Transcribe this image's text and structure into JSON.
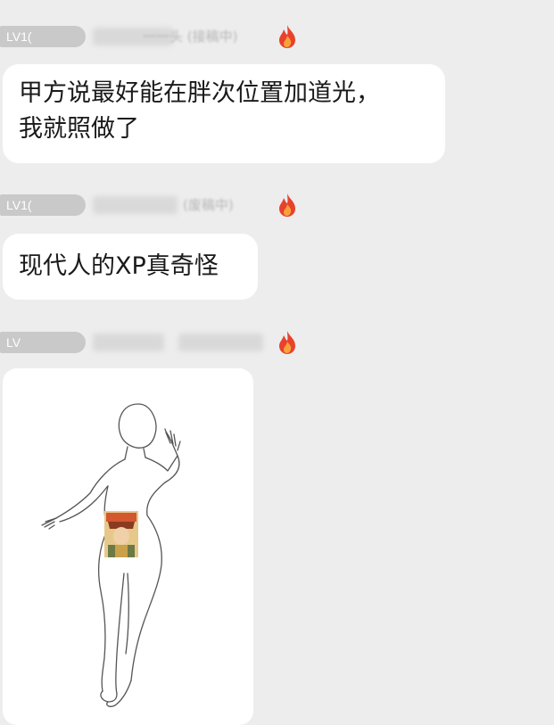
{
  "messages": [
    {
      "level": "LV1(",
      "title_fragment": "一一头 (接稿中)",
      "text": "甲方说最好能在胖次位置加道光，\n我就照做了"
    },
    {
      "level": "LV1(",
      "title_fragment": "(废稿中)",
      "text": "现代人的XP真奇怪"
    },
    {
      "level": "LV",
      "title_fragment": "",
      "image_desc": "figure-sketch-with-portrait"
    }
  ],
  "colors": {
    "background": "#ededed",
    "bubble": "#ffffff",
    "badge": "#c9c9c9",
    "flame": "#e8412c"
  },
  "icons": [
    "flame-icon"
  ]
}
